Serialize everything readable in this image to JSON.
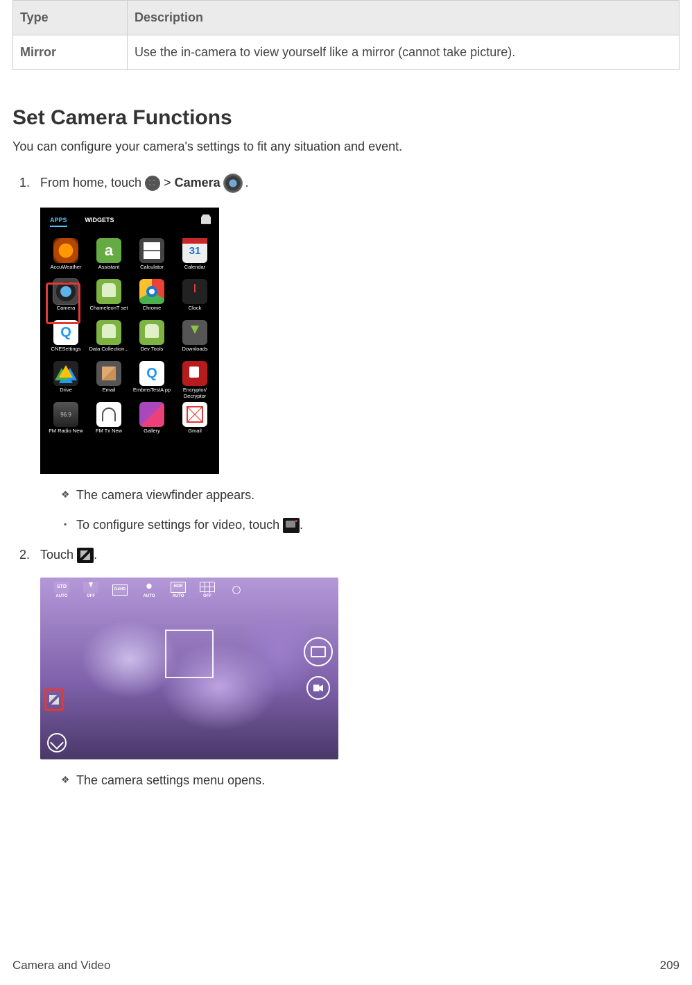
{
  "table": {
    "headers": {
      "type": "Type",
      "description": "Description"
    },
    "row": {
      "type": "Mirror",
      "description": "Use the in-camera to view yourself like a mirror (cannot take picture)."
    }
  },
  "section": {
    "title": "Set Camera Functions",
    "intro": "You can configure your camera's settings to fit any situation and event."
  },
  "steps": {
    "s1_a": "From home, touch ",
    "s1_b": " > ",
    "s1_c": "Camera",
    "s1_d": " .",
    "s2": "Touch ",
    "s2_end": "."
  },
  "bullets": {
    "viewfinder_appears": "The camera viewfinder appears.",
    "configure_video": "To configure settings for video, touch ",
    "configure_video_end": ".",
    "settings_menu_opens": "The camera settings menu opens."
  },
  "shot1": {
    "tabs": {
      "apps": "APPS",
      "widgets": "WIDGETS"
    },
    "apps": [
      {
        "label": "AccuWeather",
        "cls": "ico-accu"
      },
      {
        "label": "Assistant",
        "cls": "ico-assist",
        "letter": "a"
      },
      {
        "label": "Calculator",
        "cls": "ico-calc"
      },
      {
        "label": "Calendar",
        "cls": "ico-cal"
      },
      {
        "label": "Camera",
        "cls": "ico-camera"
      },
      {
        "label": "ChameleonT set",
        "cls": "ico-android"
      },
      {
        "label": "Chrome",
        "cls": "ico-chrome"
      },
      {
        "label": "Clock",
        "cls": "ico-clock"
      },
      {
        "label": "CNESettings",
        "cls": "ico-q",
        "letter": "Q"
      },
      {
        "label": "Data Collection...",
        "cls": "ico-android"
      },
      {
        "label": "Dev Tools",
        "cls": "ico-android"
      },
      {
        "label": "Downloads",
        "cls": "ico-downloads"
      },
      {
        "label": "Drive",
        "cls": "ico-drive"
      },
      {
        "label": "Email",
        "cls": "ico-email"
      },
      {
        "label": "EmbmsTestA pp",
        "cls": "ico-q",
        "letter": "Q"
      },
      {
        "label": "Encryptor/ Decryptor",
        "cls": "ico-encrypt"
      },
      {
        "label": "FM Radio New",
        "cls": "ico-radio"
      },
      {
        "label": "FM Tx New",
        "cls": "ico-fmtx"
      },
      {
        "label": "Gallery",
        "cls": "ico-gallery"
      },
      {
        "label": "Gmail",
        "cls": "ico-gmail"
      }
    ]
  },
  "shot2": {
    "topbar": [
      {
        "label": "AUTO",
        "cls": "std"
      },
      {
        "label": "OFF",
        "cls": "flash"
      },
      {
        "label": "",
        "cls": "hd"
      },
      {
        "label": "AUTO",
        "cls": "face"
      },
      {
        "label": "AUTO",
        "cls": "hdr"
      },
      {
        "label": "OFF",
        "cls": "grid"
      },
      {
        "label": "",
        "cls": "timer"
      }
    ]
  },
  "footer": {
    "section": "Camera and Video",
    "page": "209"
  }
}
